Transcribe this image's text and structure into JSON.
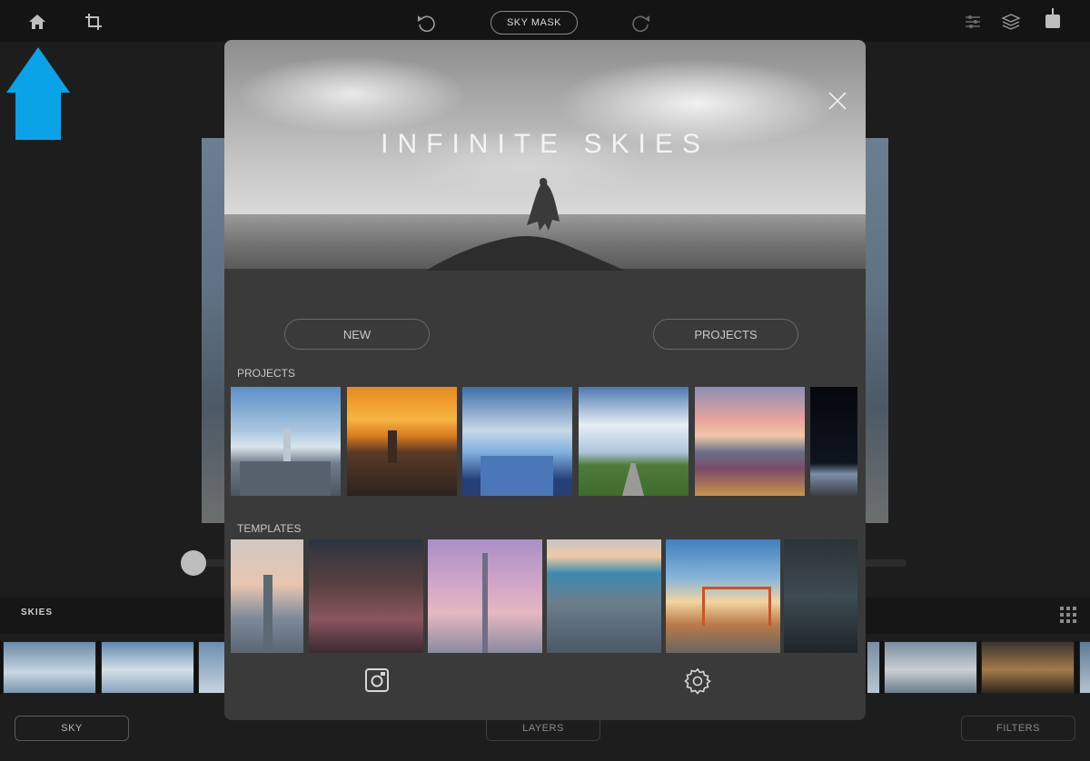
{
  "topbar": {
    "sky_mask_label": "SKY MASK",
    "icons": [
      "home-icon",
      "crop-icon",
      "undo-icon",
      "redo-icon",
      "sliders-icon",
      "layers-icon",
      "share-icon"
    ]
  },
  "modal": {
    "hero_title": "INFINITE SKIES",
    "new_label": "NEW",
    "projects_button_label": "PROJECTS",
    "projects_section_label": "PROJECTS",
    "templates_section_label": "TEMPLATES"
  },
  "background": {
    "skies_label": "SKIES",
    "bottom_buttons": {
      "sky": "SKY",
      "layers": "LAYERS",
      "filters": "FILTERS"
    }
  },
  "colors": {
    "accent_arrow": "#0aa3e8",
    "modal_bg": "#3a3a3a",
    "topbar_bg": "#141414"
  }
}
